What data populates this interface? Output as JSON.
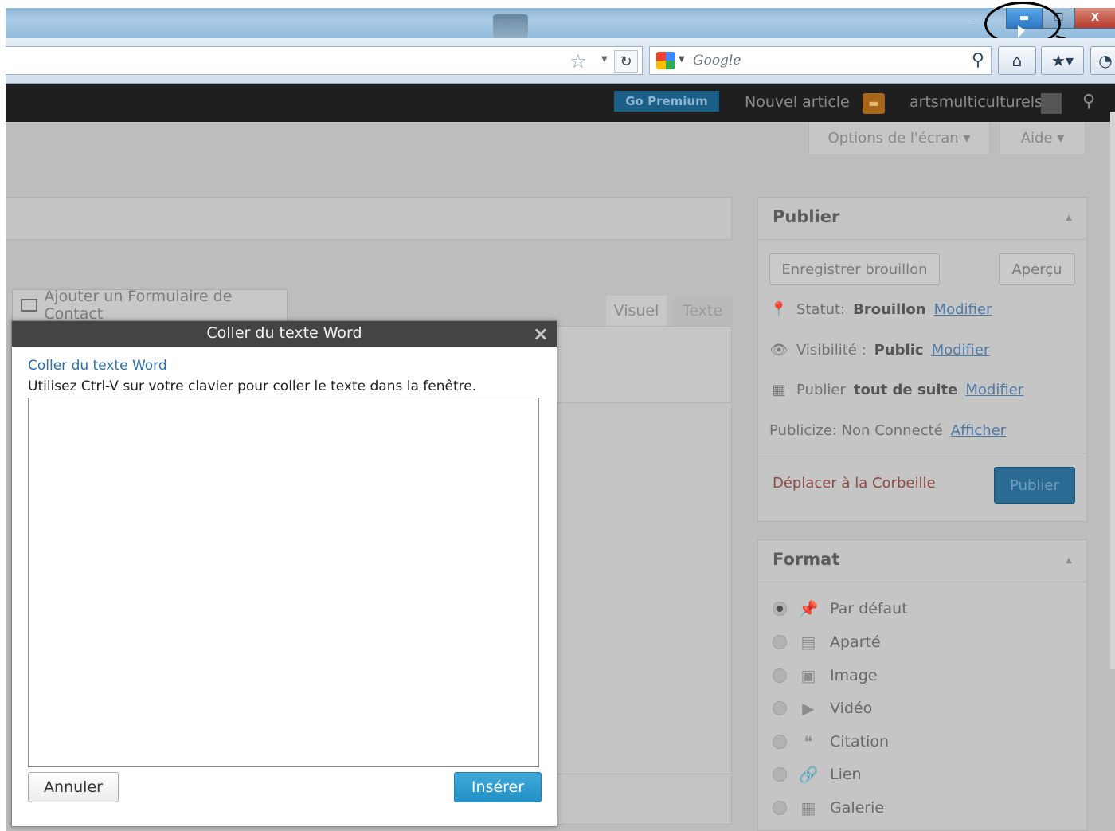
{
  "browser": {
    "search_placeholder": "Google",
    "icons": {
      "bookmark_star": "star-icon",
      "reload": "reload-icon",
      "search_engine": "google-icon",
      "search_go": "magnifier-icon",
      "home": "home-icon",
      "bookmarks": "bookmarks-icon",
      "addon": "addon-icon"
    },
    "window_controls": {
      "minimize": "minimize-icon",
      "maximize": "maximize-icon",
      "close": "close-icon",
      "close_glyph": "X"
    }
  },
  "admin_bar": {
    "go_premium": "Go Premium",
    "new_article": "Nouvel article",
    "username": "artsmulticulturels"
  },
  "screen_meta": {
    "screen_options": "Options de l'écran",
    "help": "Aide"
  },
  "editor": {
    "add_contact_form": "Ajouter un Formulaire de Contact",
    "tab_visual": "Visuel",
    "tab_text": "Texte"
  },
  "publish_box": {
    "title": "Publier",
    "save_draft": "Enregistrer brouillon",
    "preview": "Aperçu",
    "status_label": "Statut:",
    "status_value": "Brouillon",
    "status_edit": "Modifier",
    "visibility_label": "Visibilité :",
    "visibility_value": "Public",
    "visibility_edit": "Modifier",
    "publish_label": "Publier",
    "publish_value": "tout de suite",
    "publish_edit": "Modifier",
    "publicize_label": "Publicize: Non Connecté",
    "publicize_link": "Afficher",
    "trash": "Déplacer à la Corbeille",
    "publish_button": "Publier"
  },
  "format_box": {
    "title": "Format",
    "options": [
      {
        "label": "Par défaut",
        "icon": "pin-icon",
        "selected": true
      },
      {
        "label": "Aparté",
        "icon": "aside-icon",
        "selected": false
      },
      {
        "label": "Image",
        "icon": "image-icon",
        "selected": false
      },
      {
        "label": "Vidéo",
        "icon": "video-icon",
        "selected": false
      },
      {
        "label": "Citation",
        "icon": "quote-icon",
        "selected": false
      },
      {
        "label": "Lien",
        "icon": "link-icon",
        "selected": false
      },
      {
        "label": "Galerie",
        "icon": "gallery-icon",
        "selected": false
      }
    ]
  },
  "dialog": {
    "title": "Coller du texte Word",
    "subtitle": "Coller du texte Word",
    "instructions": "Utilisez Ctrl-V sur votre clavier pour coller le texte dans la fenêtre.",
    "cancel": "Annuler",
    "insert": "Insérer"
  },
  "colors": {
    "admin_bar": "#1f1f1f",
    "insert_button": "#2390c6",
    "link": "#2f6fa6",
    "overlay_gray": "#bdbdbd"
  }
}
